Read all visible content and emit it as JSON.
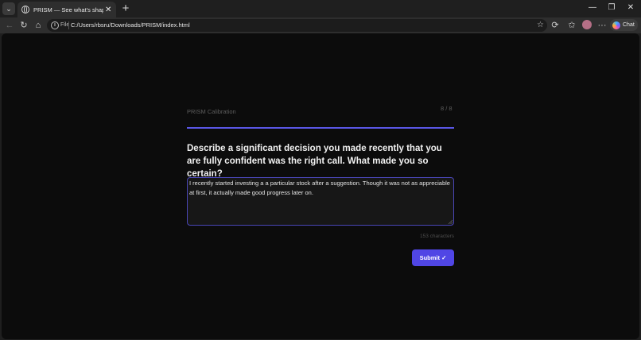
{
  "browser": {
    "tab_title": "PRISM — See what's shaping your",
    "tab_close": "✕",
    "new_tab": "+",
    "window": {
      "minimize": "—",
      "restore": "❐",
      "close": "✕"
    },
    "address": {
      "scheme_label": "File",
      "url": "C:/Users/rbsru/Downloads/PRISM/index.html"
    },
    "chat_label": "Chat"
  },
  "page": {
    "header_title": "PRISM Calibration",
    "progress": {
      "label": "8 / 8",
      "current": 8,
      "total": 8,
      "fraction": 1.0
    },
    "question": "Describe a significant decision you made recently that you are fully confident was the right call. What made you so certain?",
    "answer": "I recently started investing a a particular stock after a suggestion. Though it was not as appreciable at first, it actually made good progress later on.",
    "char_count": "153 characters",
    "submit_label": "Submit ✓"
  },
  "colors": {
    "accent": "#5046e5",
    "progress_fill": "#5a57e6",
    "page_background": "#0c0c0c"
  }
}
